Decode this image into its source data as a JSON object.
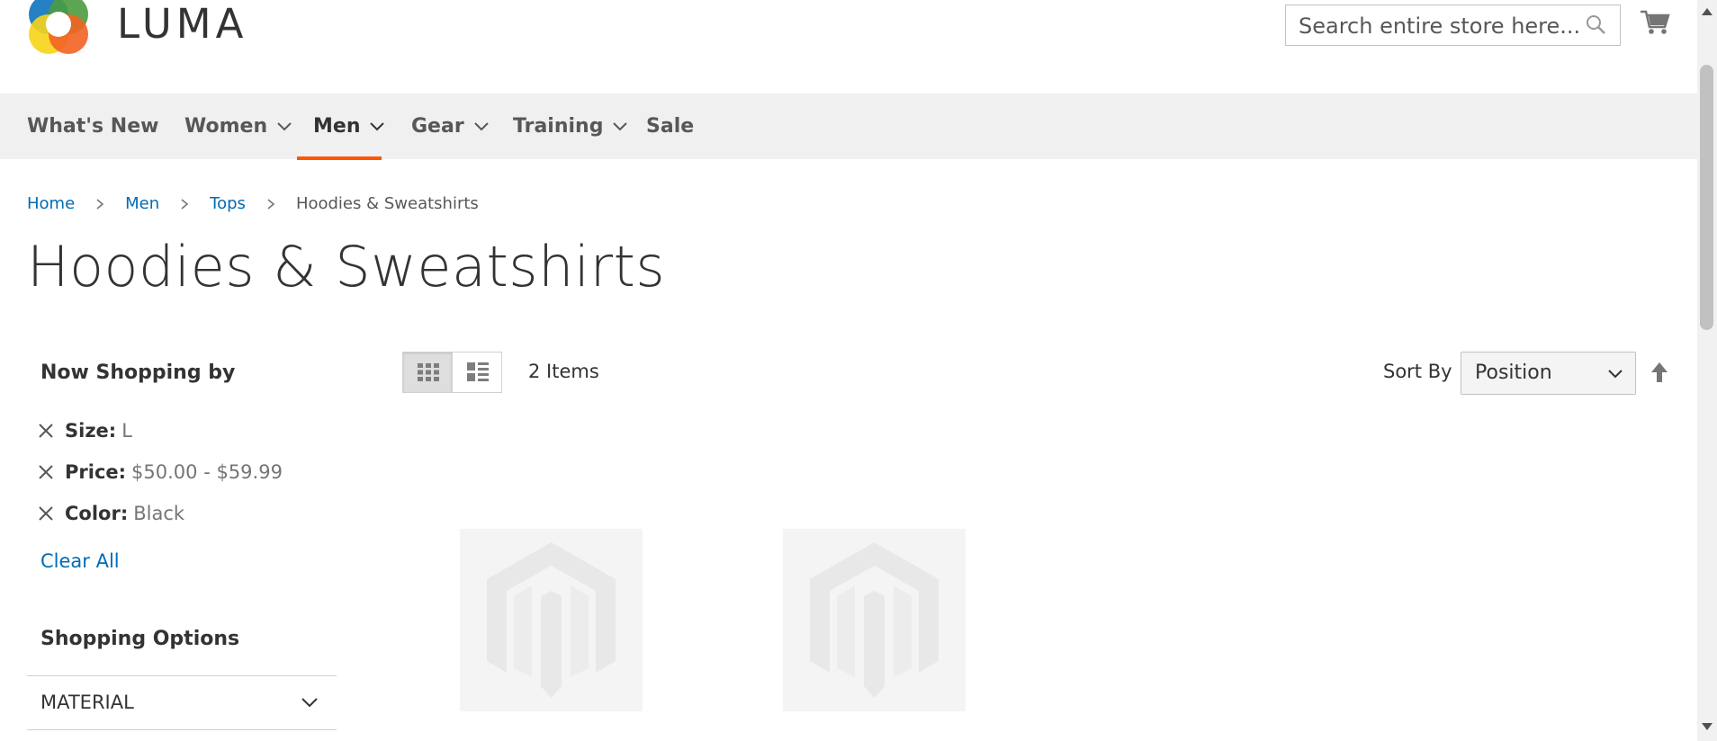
{
  "header": {
    "brand": "LUMA",
    "search_placeholder": "Search entire store here..."
  },
  "nav": {
    "items": [
      {
        "label": "What's New",
        "dropdown": false
      },
      {
        "label": "Women",
        "dropdown": true
      },
      {
        "label": "Men",
        "dropdown": true,
        "active": true
      },
      {
        "label": "Gear",
        "dropdown": true
      },
      {
        "label": "Training",
        "dropdown": true
      },
      {
        "label": "Sale",
        "dropdown": false
      }
    ]
  },
  "breadcrumb": [
    {
      "label": "Home",
      "link": true
    },
    {
      "label": "Men",
      "link": true
    },
    {
      "label": "Tops",
      "link": true
    },
    {
      "label": "Hoodies & Sweatshirts",
      "link": false
    }
  ],
  "page_title": "Hoodies & Sweatshirts",
  "sidebar": {
    "now_shopping_title": "Now Shopping by",
    "filters": [
      {
        "label": "Size:",
        "value": "L"
      },
      {
        "label": "Price:",
        "value": "$50.00 - $59.99"
      },
      {
        "label": "Color:",
        "value": "Black"
      }
    ],
    "clear_all": "Clear All",
    "shopping_options_title": "Shopping Options",
    "sections": [
      {
        "label": "MATERIAL"
      }
    ]
  },
  "toolbar": {
    "count": "2 Items",
    "sort_label": "Sort By",
    "sort_value": "Position",
    "view_mode": "grid"
  },
  "colors": {
    "accent": "#ff5501",
    "link": "#006bb4",
    "nav_bg": "#f0f0f0"
  }
}
